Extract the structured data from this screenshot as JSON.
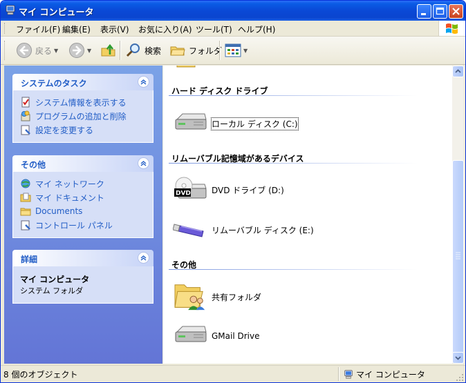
{
  "window": {
    "title": "マイ コンピュータ",
    "colors": {
      "titlebar": "#0a49d6",
      "accent": "#215dc6",
      "taskpane": "#6f8fe0"
    }
  },
  "menu": [
    {
      "label": "ファイル(F)"
    },
    {
      "label": "編集(E)"
    },
    {
      "label": "表示(V)"
    },
    {
      "label": "お気に入り(A)"
    },
    {
      "label": "ツール(T)"
    },
    {
      "label": "ヘルプ(H)"
    }
  ],
  "toolbar": {
    "back": "戻る",
    "search": "検索",
    "folders": "フォルダ"
  },
  "tasks": {
    "system": {
      "title": "システムのタスク",
      "items": [
        "システム情報を表示する",
        "プログラムの追加と削除",
        "設定を変更する"
      ]
    },
    "other": {
      "title": "その他",
      "items": [
        "マイ ネットワーク",
        "マイ ドキュメント",
        "Documents",
        "コントロール パネル"
      ]
    },
    "details": {
      "title": "詳細",
      "name": "マイ コンピュータ",
      "type": "システム フォルダ"
    }
  },
  "content": {
    "groups": [
      {
        "title": "ハード ディスク ドライブ",
        "items": [
          "ローカル ディスク (C:)"
        ]
      },
      {
        "title": "リムーバブル記憶域があるデバイス",
        "items": [
          "DVD ドライブ (D:)",
          "リムーバブル ディスク (E:)"
        ]
      },
      {
        "title": "その他",
        "items": [
          "共有フォルダ",
          "GMail Drive"
        ]
      }
    ]
  },
  "status": {
    "count": "8 個のオブジェクト",
    "location": "マイ コンピュータ"
  }
}
